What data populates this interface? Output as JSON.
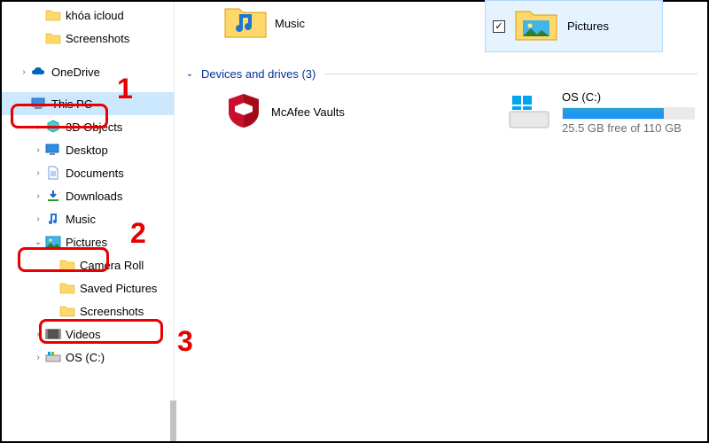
{
  "sidebar": {
    "items": [
      {
        "label": "khóa icloud",
        "chev": "",
        "lvl": "lvl2",
        "icon": "folder"
      },
      {
        "label": "Screenshots",
        "chev": "",
        "lvl": "lvl2",
        "icon": "folder"
      },
      {
        "label": "OneDrive",
        "chev": ">",
        "lvl": "lvl1",
        "icon": "onedrive"
      },
      {
        "label": "This PC",
        "chev": "v",
        "lvl": "lvl1",
        "icon": "thispc",
        "selected": true
      },
      {
        "label": "3D Objects",
        "chev": ">",
        "lvl": "lvl2",
        "icon": "3d"
      },
      {
        "label": "Desktop",
        "chev": ">",
        "lvl": "lvl2",
        "icon": "desktop"
      },
      {
        "label": "Documents",
        "chev": ">",
        "lvl": "lvl2",
        "icon": "documents"
      },
      {
        "label": "Downloads",
        "chev": ">",
        "lvl": "lvl2",
        "icon": "downloads"
      },
      {
        "label": "Music",
        "chev": ">",
        "lvl": "lvl2",
        "icon": "music"
      },
      {
        "label": "Pictures",
        "chev": "v",
        "lvl": "lvl2",
        "icon": "pictures"
      },
      {
        "label": "Camera Roll",
        "chev": "",
        "lvl": "lvl3",
        "icon": "folder"
      },
      {
        "label": "Saved Pictures",
        "chev": "",
        "lvl": "lvl3",
        "icon": "folder"
      },
      {
        "label": "Screenshots",
        "chev": "",
        "lvl": "lvl3",
        "icon": "folder"
      },
      {
        "label": "Videos",
        "chev": ">",
        "lvl": "lvl2",
        "icon": "videos"
      },
      {
        "label": "OS (C:)",
        "chev": ">",
        "lvl": "lvl2",
        "icon": "drive"
      }
    ]
  },
  "main": {
    "music_label": "Music",
    "selected_item_label": "Pictures",
    "section_header": "Devices and drives (3)",
    "mcafee_label": "McAfee Vaults",
    "drive": {
      "name": "OS (C:)",
      "subtext": "25.5 GB free of 110 GB",
      "fill_percent": 77
    }
  },
  "annotations": {
    "num1": "1",
    "num2": "2",
    "num3": "3"
  }
}
